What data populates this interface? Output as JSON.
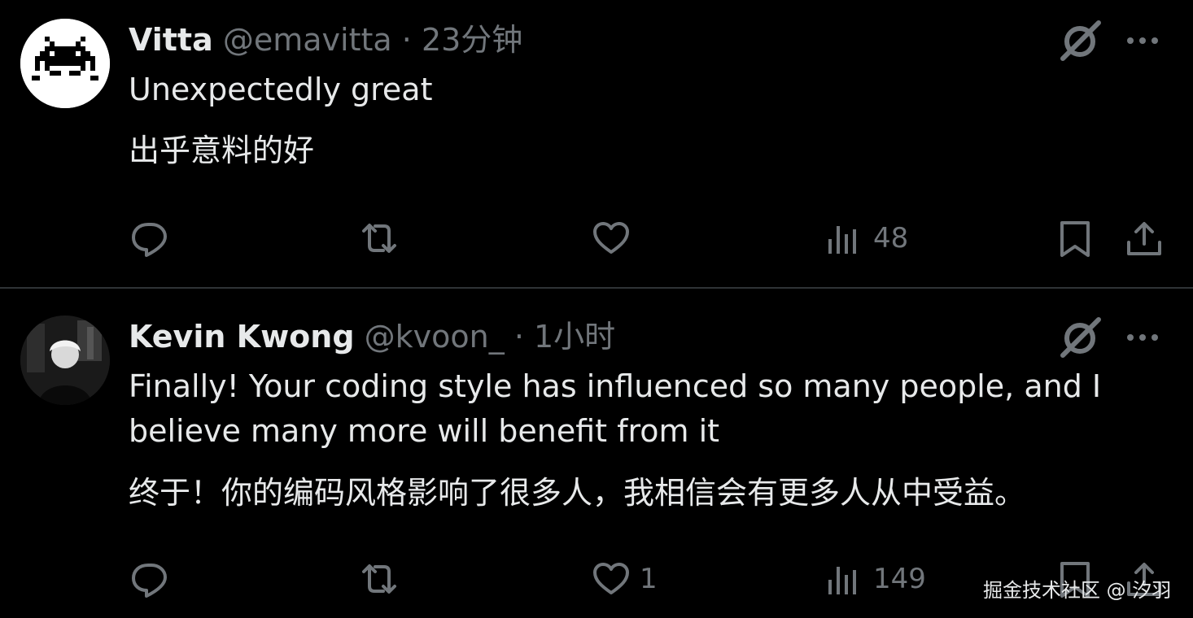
{
  "tweets": [
    {
      "author": "Vitta",
      "handle": "@emavitta",
      "separator": "·",
      "time": "23分钟",
      "text_en": "Unexpectedly great",
      "text_zh": "出乎意料的好",
      "replies": "",
      "retweets": "",
      "likes": "",
      "views": "48"
    },
    {
      "author": "Kevin Kwong",
      "handle": "@kvoon_",
      "separator": "·",
      "time": "1小时",
      "text_en": "Finally! Your coding style has influenced so many people, and I believe many more will benefit from it",
      "text_zh": "终于！你的编码风格影响了很多人，我相信会有更多人从中受益。",
      "replies": "",
      "retweets": "",
      "likes": "1",
      "views": "149"
    }
  ],
  "watermark": "掘金技术社区 @ 汐羽",
  "icons": [
    "grok-icon",
    "more-icon",
    "reply-icon",
    "retweet-icon",
    "like-icon",
    "views-icon",
    "bookmark-icon",
    "share-icon"
  ],
  "colors": {
    "background": "#000000",
    "text": "#e7e9ea",
    "muted": "#71767b",
    "divider": "#2f3336"
  }
}
